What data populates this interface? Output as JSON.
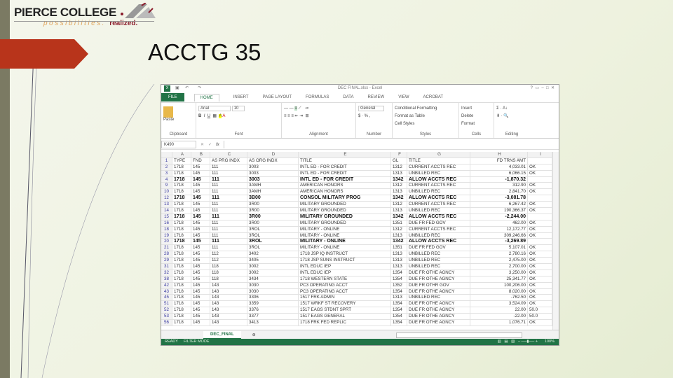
{
  "slide": {
    "title": "ACCTG 35"
  },
  "logo": {
    "name": "PIERCE COLLEGE",
    "tagline": "possibilities.",
    "tagline_bold": "realized."
  },
  "excel": {
    "window_title": "DEC FINAL.xlsx - Excel",
    "tabs": [
      "FILE",
      "HOME",
      "INSERT",
      "PAGE LAYOUT",
      "FORMULAS",
      "DATA",
      "REVIEW",
      "VIEW",
      "ACROBAT"
    ],
    "clipboard": {
      "paste": "Paste",
      "label": "Clipboard"
    },
    "font": {
      "name": "Arial",
      "size": "10",
      "label": "Font"
    },
    "alignment": {
      "label": "Alignment"
    },
    "number": {
      "format": "General",
      "label": "Number"
    },
    "styles": {
      "items": [
        "Conditional Formatting",
        "Format as Table",
        "Cell Styles"
      ],
      "label": "Styles"
    },
    "cells": {
      "items": [
        "Insert",
        "Delete",
        "Format"
      ],
      "label": "Cells"
    },
    "editing": {
      "label": "Editing"
    },
    "name_box": "K490",
    "fx": "fx",
    "columns": [
      "A",
      "B",
      "C",
      "D",
      "E",
      "F",
      "G",
      "H",
      "I"
    ],
    "headers": [
      "TYPE",
      "FND",
      "AS PRG INDX",
      "AS ORG INDX",
      "TITLE",
      "GL",
      "TITLE",
      "FD TRNS AMT",
      ""
    ],
    "rows": [
      {
        "n": "2",
        "v": [
          "1718",
          "145",
          "111",
          "3003",
          "INTL ED - FOR CREDIT",
          "1312",
          "CURRENT ACCTS REC",
          "4,033.01",
          "OK"
        ]
      },
      {
        "n": "3",
        "v": [
          "1718",
          "145",
          "111",
          "3003",
          "INTL ED - FOR CREDIT",
          "1313",
          "UNBILLED REC",
          "6,066.15",
          "OK"
        ]
      },
      {
        "n": "4",
        "bold": true,
        "v": [
          "1718",
          "145",
          "111",
          "3003",
          "INTL ED - FOR CREDIT",
          "1342",
          "ALLOW ACCTS REC",
          "-1,870.32",
          ""
        ]
      },
      {
        "n": "9",
        "v": [
          "1718",
          "145",
          "111",
          "3AMH",
          "AMERICAN HONORS",
          "1312",
          "CURRENT ACCTS REC",
          "312.90",
          "OK"
        ]
      },
      {
        "n": "10",
        "v": [
          "1718",
          "145",
          "111",
          "3AMH",
          "AMERICAN HONORS",
          "1313",
          "UNBILLED REC",
          "2,841.70",
          "OK"
        ]
      },
      {
        "n": "12",
        "bold": true,
        "v": [
          "1718",
          "145",
          "111",
          "3B00",
          "CONSOL MILITARY PROG",
          "1342",
          "ALLOW ACCTS REC",
          "-3,081.78",
          ""
        ]
      },
      {
        "n": "13",
        "v": [
          "1718",
          "145",
          "111",
          "3R00",
          "MILITARY GROUNDED",
          "1312",
          "CURRENT ACCTS REC",
          "6,267.42",
          "OK"
        ]
      },
      {
        "n": "14",
        "v": [
          "1718",
          "145",
          "111",
          "3R00",
          "MILITARY GROUNDED",
          "1313",
          "UNBILLED REC",
          "190,366.37",
          "OK"
        ]
      },
      {
        "n": "15",
        "bold": true,
        "v": [
          "1718",
          "145",
          "111",
          "3R00",
          "MILITARY GROUNDED",
          "1342",
          "ALLOW ACCTS REC",
          "-2,244.00",
          ""
        ]
      },
      {
        "n": "16",
        "v": [
          "1718",
          "145",
          "111",
          "3R00",
          "MILITARY GROUNDED",
          "1351",
          "DUE FR FED GOV",
          "462.00",
          "OK"
        ]
      },
      {
        "n": "18",
        "v": [
          "1718",
          "145",
          "111",
          "3ROL",
          "MILITARY - ONLINE",
          "1312",
          "CURRENT ACCTS REC",
          "12,172.77",
          "OK"
        ]
      },
      {
        "n": "19",
        "v": [
          "1718",
          "145",
          "111",
          "3ROL",
          "MILITARY - ONLINE",
          "1313",
          "UNBILLED REC",
          "309,246.66",
          "OK"
        ]
      },
      {
        "n": "20",
        "bold": true,
        "v": [
          "1718",
          "145",
          "111",
          "3ROL",
          "MILITARY - ONLINE",
          "1342",
          "ALLOW ACCTS REC",
          "-3,269.89",
          ""
        ]
      },
      {
        "n": "21",
        "v": [
          "1718",
          "145",
          "111",
          "3ROL",
          "MILITARY - ONLINE",
          "1351",
          "DUE FR FED GOV",
          "5,107.01",
          "OK"
        ]
      },
      {
        "n": "28",
        "v": [
          "1718",
          "145",
          "112",
          "3402",
          "1718 JSP IQ INSTRUCT",
          "1313",
          "UNBILLED REC",
          "2,780.16",
          "OK"
        ]
      },
      {
        "n": "29",
        "v": [
          "1718",
          "145",
          "112",
          "3405",
          "1718 JSP SUNS INSTRUCT",
          "1313",
          "UNBILLED REC",
          "2,475.00",
          "OK"
        ]
      },
      {
        "n": "31",
        "v": [
          "1718",
          "145",
          "118",
          "3002",
          "INTL EDUC IEP",
          "1313",
          "UNBILLED REC",
          "2,700.00",
          "OK"
        ]
      },
      {
        "n": "32",
        "v": [
          "1718",
          "145",
          "118",
          "3002",
          "INTL EDUC IEP",
          "1354",
          "DUE FR OTHE AGNCY",
          "3,250.00",
          "OK"
        ]
      },
      {
        "n": "38",
        "v": [
          "1718",
          "145",
          "118",
          "3434",
          "1718 WESTERN STATE",
          "1354",
          "DUE FR OTHE AGNCY",
          "25,341.77",
          "OK"
        ]
      },
      {
        "n": "42",
        "v": [
          "1718",
          "145",
          "143",
          "3030",
          "PC3 OPERATING ACCT",
          "1352",
          "DUE FR OTHR GOV",
          "100,206.00",
          "OK"
        ]
      },
      {
        "n": "43",
        "v": [
          "1718",
          "145",
          "143",
          "3030",
          "PC3 OPERATING ACCT",
          "1354",
          "DUE FR OTHE AGNCY",
          "8,020.00",
          "OK"
        ]
      },
      {
        "n": "45",
        "v": [
          "1718",
          "145",
          "143",
          "3306",
          "1517 FRK ADMIN",
          "1313",
          "UNBILLED REC",
          "-762.50",
          "OK"
        ]
      },
      {
        "n": "51",
        "v": [
          "1718",
          "145",
          "143",
          "3359",
          "1517 WRKF ST RECOVERY",
          "1354",
          "DUE FR OTHE AGNCY",
          "3,524.09",
          "OK"
        ]
      },
      {
        "n": "52",
        "v": [
          "1718",
          "145",
          "143",
          "3376",
          "1517 EAGS STDNT SPRT",
          "1354",
          "DUE FR OTHE AGNCY",
          "22.00",
          "50.0"
        ]
      },
      {
        "n": "53",
        "v": [
          "1718",
          "145",
          "143",
          "3377",
          "1517 EAGS GENERAL",
          "1354",
          "DUE FR OTHE AGNCY",
          "-22.00",
          "50.0"
        ]
      },
      {
        "n": "56",
        "v": [
          "1718",
          "145",
          "143",
          "3413",
          "1718 FRK FED REPLIC",
          "1354",
          "DUE FR OTHE AGNCY",
          "1,076.71",
          "OK"
        ]
      }
    ],
    "sheet_tab": "DEC_FINAL",
    "status": {
      "ready": "READY",
      "mode": "FILTER MODE",
      "zoom": "100%"
    }
  }
}
